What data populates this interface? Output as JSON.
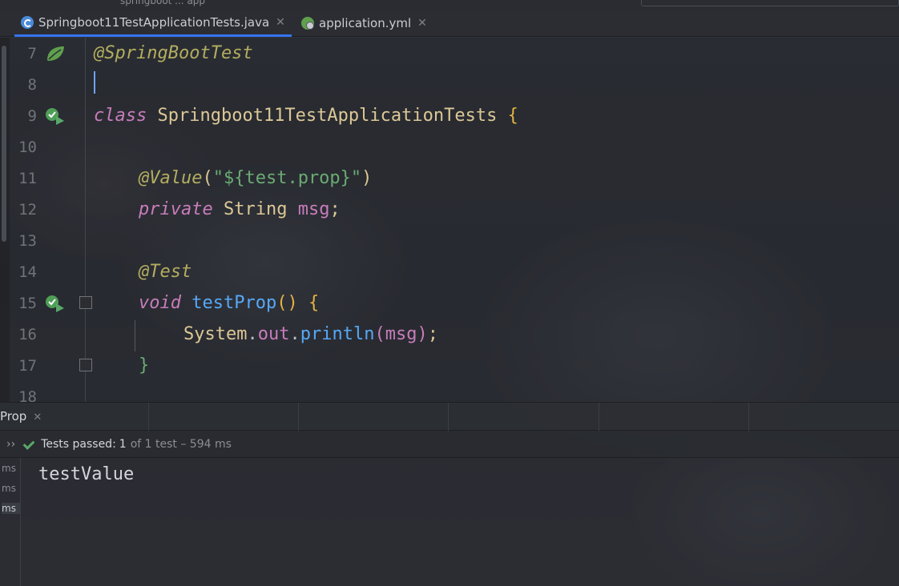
{
  "window": {
    "breadcrumb_partial": "springboot ... app",
    "left_marker": "-"
  },
  "tabs": [
    {
      "label": "Springboot11TestApplicationTests.java",
      "icon": "java-class-icon",
      "active": true
    },
    {
      "label": "application.yml",
      "icon": "spring-config-icon",
      "active": false
    }
  ],
  "editor": {
    "lines": [
      {
        "num": "7",
        "gutter_icon": "spring-bean-icon"
      },
      {
        "num": "8",
        "gutter_icon": ""
      },
      {
        "num": "9",
        "gutter_icon": "run-test-icon"
      },
      {
        "num": "10",
        "gutter_icon": ""
      },
      {
        "num": "11",
        "gutter_icon": ""
      },
      {
        "num": "12",
        "gutter_icon": ""
      },
      {
        "num": "13",
        "gutter_icon": ""
      },
      {
        "num": "14",
        "gutter_icon": ""
      },
      {
        "num": "15",
        "gutter_icon": "run-test-icon"
      },
      {
        "num": "16",
        "gutter_icon": ""
      },
      {
        "num": "17",
        "gutter_icon": ""
      },
      {
        "num": "18",
        "gutter_icon": ""
      }
    ],
    "code": {
      "l7_annotation": "@SpringBootTest",
      "l9_kw": "class",
      "l9_name": "Springboot11TestApplicationTests",
      "l9_brace": "{",
      "l11_annotation": "@Value",
      "l11_paren_open": "(",
      "l11_string": "\"${test.prop}\"",
      "l11_paren_close": ")",
      "l12_kw": "private",
      "l12_type": "String",
      "l12_field": "msg",
      "l12_semi": ";",
      "l14_annotation": "@Test",
      "l15_kw": "void",
      "l15_method": "testProp",
      "l15_parens": "()",
      "l15_brace": "{",
      "l16_class": "System",
      "l16_dot1": ".",
      "l16_out": "out",
      "l16_dot2": ".",
      "l16_println": "println",
      "l16_open": "(",
      "l16_arg": "msg",
      "l16_close": ")",
      "l16_semi": ";",
      "l17_brace": "}"
    }
  },
  "run_panel": {
    "tab_label": "Prop",
    "status": {
      "passed_label": "Tests passed:",
      "passed_count": "1",
      "rest": "of 1 test – 594 ms"
    },
    "tree_ms": [
      "ms",
      "ms",
      "ms"
    ],
    "output": "testValue"
  },
  "colors": {
    "accent": "#3574f0",
    "success": "#59a869",
    "annotation": "#b3ae60",
    "keyword": "#c77dbb",
    "string": "#6aab73",
    "method": "#56a8f5"
  }
}
